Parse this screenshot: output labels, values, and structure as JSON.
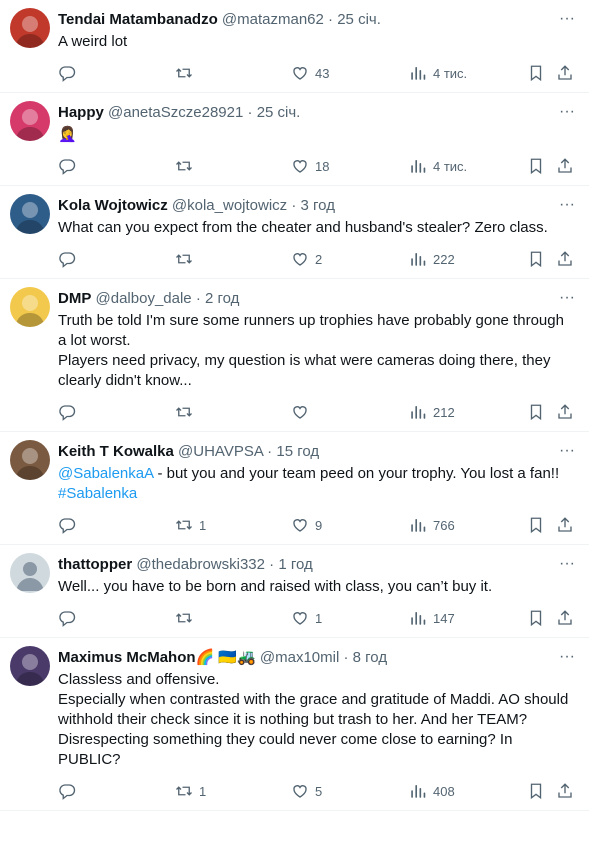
{
  "tweets": [
    {
      "name": "Tendai Matambanadzo",
      "handle": "@matazman62",
      "time": "25 січ.",
      "body": [
        "A weird lot"
      ],
      "replies": "",
      "retweets": "",
      "likes": "43",
      "views": "4 тис.",
      "avatar_color": "#c0392b"
    },
    {
      "name": "Happy",
      "handle": "@anetaSzcze28921",
      "time": "25 січ.",
      "body": [
        "🤦‍♀️"
      ],
      "replies": "",
      "retweets": "",
      "likes": "18",
      "views": "4 тис.",
      "avatar_color": "#d63a6a"
    },
    {
      "name": "Kola Wojtowicz",
      "handle": "@kola_wojtowicz",
      "time": "3 год",
      "body": [
        "What can you expect from the cheater and husband's stealer? Zero class."
      ],
      "replies": "",
      "retweets": "",
      "likes": "2",
      "views": "222",
      "avatar_color": "#2f5d8a"
    },
    {
      "name": "DMP",
      "handle": "@dalboy_dale",
      "time": "2 год",
      "body": [
        "Truth be told I'm sure some runners up trophies have probably gone through a lot worst.",
        "Players need privacy, my question is what were cameras doing there, they clearly didn't know..."
      ],
      "replies": "",
      "retweets": "",
      "likes": "",
      "views": "212",
      "avatar_color": "#f2c94c"
    },
    {
      "name": "Keith T Kowalka",
      "handle": "@UHAVPSA",
      "time": "15 год",
      "body_mention": "@SabalenkaA",
      "body_rest": " - but you and your team peed on your trophy.  You lost a fan!!",
      "body_tag": "#Sabalenka",
      "replies": "",
      "retweets": "1",
      "likes": "9",
      "views": "766",
      "avatar_color": "#7a5a40"
    },
    {
      "name": "thattopper",
      "handle": "@thedabrowski332",
      "time": "1 год",
      "body": [
        "Well... you have to be born and raised with class, you can’t buy it."
      ],
      "replies": "",
      "retweets": "",
      "likes": "1",
      "views": "147",
      "avatar_color": "#cfd9de"
    },
    {
      "name": "Maximus McMahon🌈 🇺🇦🚜",
      "handle": "@max10mil",
      "time": "8 год",
      "body": [
        "Classless and offensive.",
        "Especially when contrasted with the grace and gratitude of Maddi. AO should withhold their check since it is nothing but trash to her. And her TEAM? Disrespecting something they could never come close to earning? In PUBLIC?"
      ],
      "replies": "",
      "retweets": "1",
      "likes": "5",
      "views": "408",
      "avatar_color": "#4a3a6a"
    }
  ],
  "separator": "·",
  "more_glyph": "···"
}
